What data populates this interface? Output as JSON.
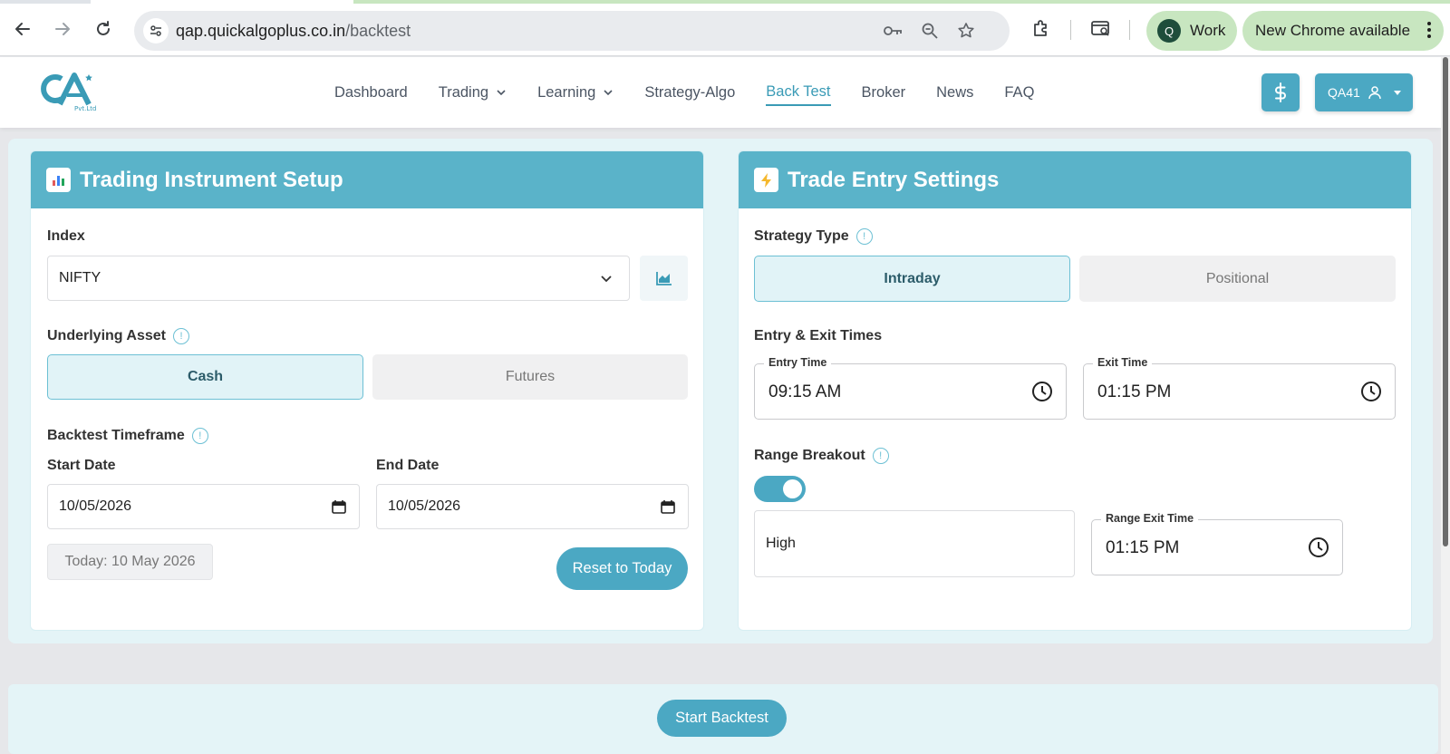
{
  "browser": {
    "url_host": "qap.quickalgoplus.co.in",
    "url_path": "/backtest",
    "profile_initial": "Q",
    "profile_label": "Work",
    "update_label": "New Chrome available"
  },
  "nav": {
    "items": [
      {
        "label": "Dashboard"
      },
      {
        "label": "Trading"
      },
      {
        "label": "Learning"
      },
      {
        "label": "Strategy-Algo"
      },
      {
        "label": "Back Test"
      },
      {
        "label": "Broker"
      },
      {
        "label": "News"
      },
      {
        "label": "FAQ"
      }
    ],
    "active": "Back Test",
    "user_label": "QA41"
  },
  "instrument": {
    "title": "Trading Instrument Setup",
    "index_label": "Index",
    "index_value": "NIFTY",
    "underlying_label": "Underlying Asset",
    "underlying_options": [
      "Cash",
      "Futures"
    ],
    "underlying_selected": "Cash",
    "timeframe_label": "Backtest Timeframe",
    "start_label": "Start Date",
    "start_value": "10/05/2026",
    "end_label": "End Date",
    "end_value": "10/05/2026",
    "today_chip": "Today: 10 May 2026",
    "reset_label": "Reset to Today"
  },
  "entry": {
    "title": "Trade Entry Settings",
    "strategy_label": "Strategy Type",
    "strategy_options": [
      "Intraday",
      "Positional"
    ],
    "strategy_selected": "Intraday",
    "times_label": "Entry & Exit Times",
    "entry_time_label": "Entry Time",
    "entry_time_value": "09:15 AM",
    "exit_time_label": "Exit Time",
    "exit_time_value": "01:15 PM",
    "range_label": "Range Breakout",
    "range_enabled": true,
    "range_type_value": "High",
    "range_exit_label": "Range Exit Time",
    "range_exit_value": "01:15 PM"
  },
  "footer": {
    "start_label": "Start Backtest"
  },
  "colors": {
    "accent": "#4ba8c3",
    "header": "#5ab3c9",
    "tint": "#e4f4f7"
  },
  "logo_text": "QA Pvt.Ltd"
}
